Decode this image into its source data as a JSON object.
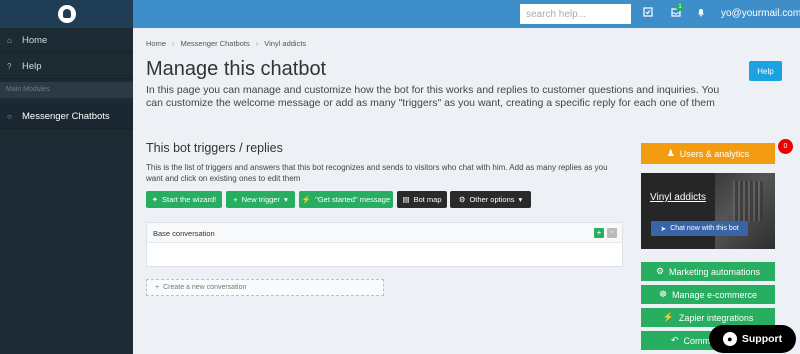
{
  "topbar": {
    "search_placeholder": "search help...",
    "notif_count": "1",
    "user_email": "yo@yourmail.com"
  },
  "sidebar": {
    "items": [
      {
        "icon": "home-icon",
        "label": "Home"
      },
      {
        "icon": "question-icon",
        "label": "Help"
      }
    ],
    "section_label": "Main Modules",
    "active_item": {
      "icon": "chat-bubbles-icon",
      "label": "Messenger Chatbots"
    }
  },
  "breadcrumb": [
    "Home",
    "Messenger Chatbots",
    "Vinyl addicts"
  ],
  "page": {
    "title": "Manage this chatbot",
    "description": "In this page you can manage and customize how the bot for this works and replies to customer questions and inquiries. You can customize the welcome message or add as many \"triggers\" as you want, creating a specific reply for each one of them",
    "help_label": "Help"
  },
  "triggers": {
    "title": "This bot triggers / replies",
    "description": "This is the list of triggers and answers that this bot recognizes and sends to visitors who chat with him. Add as many replies as you want and click on existing ones to edit them",
    "buttons": {
      "wizard": "Start the wizard!",
      "new_trigger": "New trigger",
      "get_started": "\"Get started\" message",
      "bot_map": "Bot map",
      "other_options": "Other options"
    },
    "conversation_title": "Base conversation",
    "new_conversation": "Create a new conversation"
  },
  "right": {
    "users_analytics": "Users & analytics",
    "users_badge": "0",
    "bot_name": "Vinyl addicts",
    "chat_now": "Chat now with this bot",
    "marketing": "Marketing automations",
    "ecommerce": "Manage e-commerce",
    "zapier": "Zapier integrations",
    "comments": "Comments"
  },
  "support": {
    "label": "Support"
  },
  "colors": {
    "topbar": "#3d8ec9",
    "sidebar": "#1c2a33",
    "green": "#27ae60",
    "orange": "#f39c12",
    "help_blue": "#1aa3e0"
  }
}
